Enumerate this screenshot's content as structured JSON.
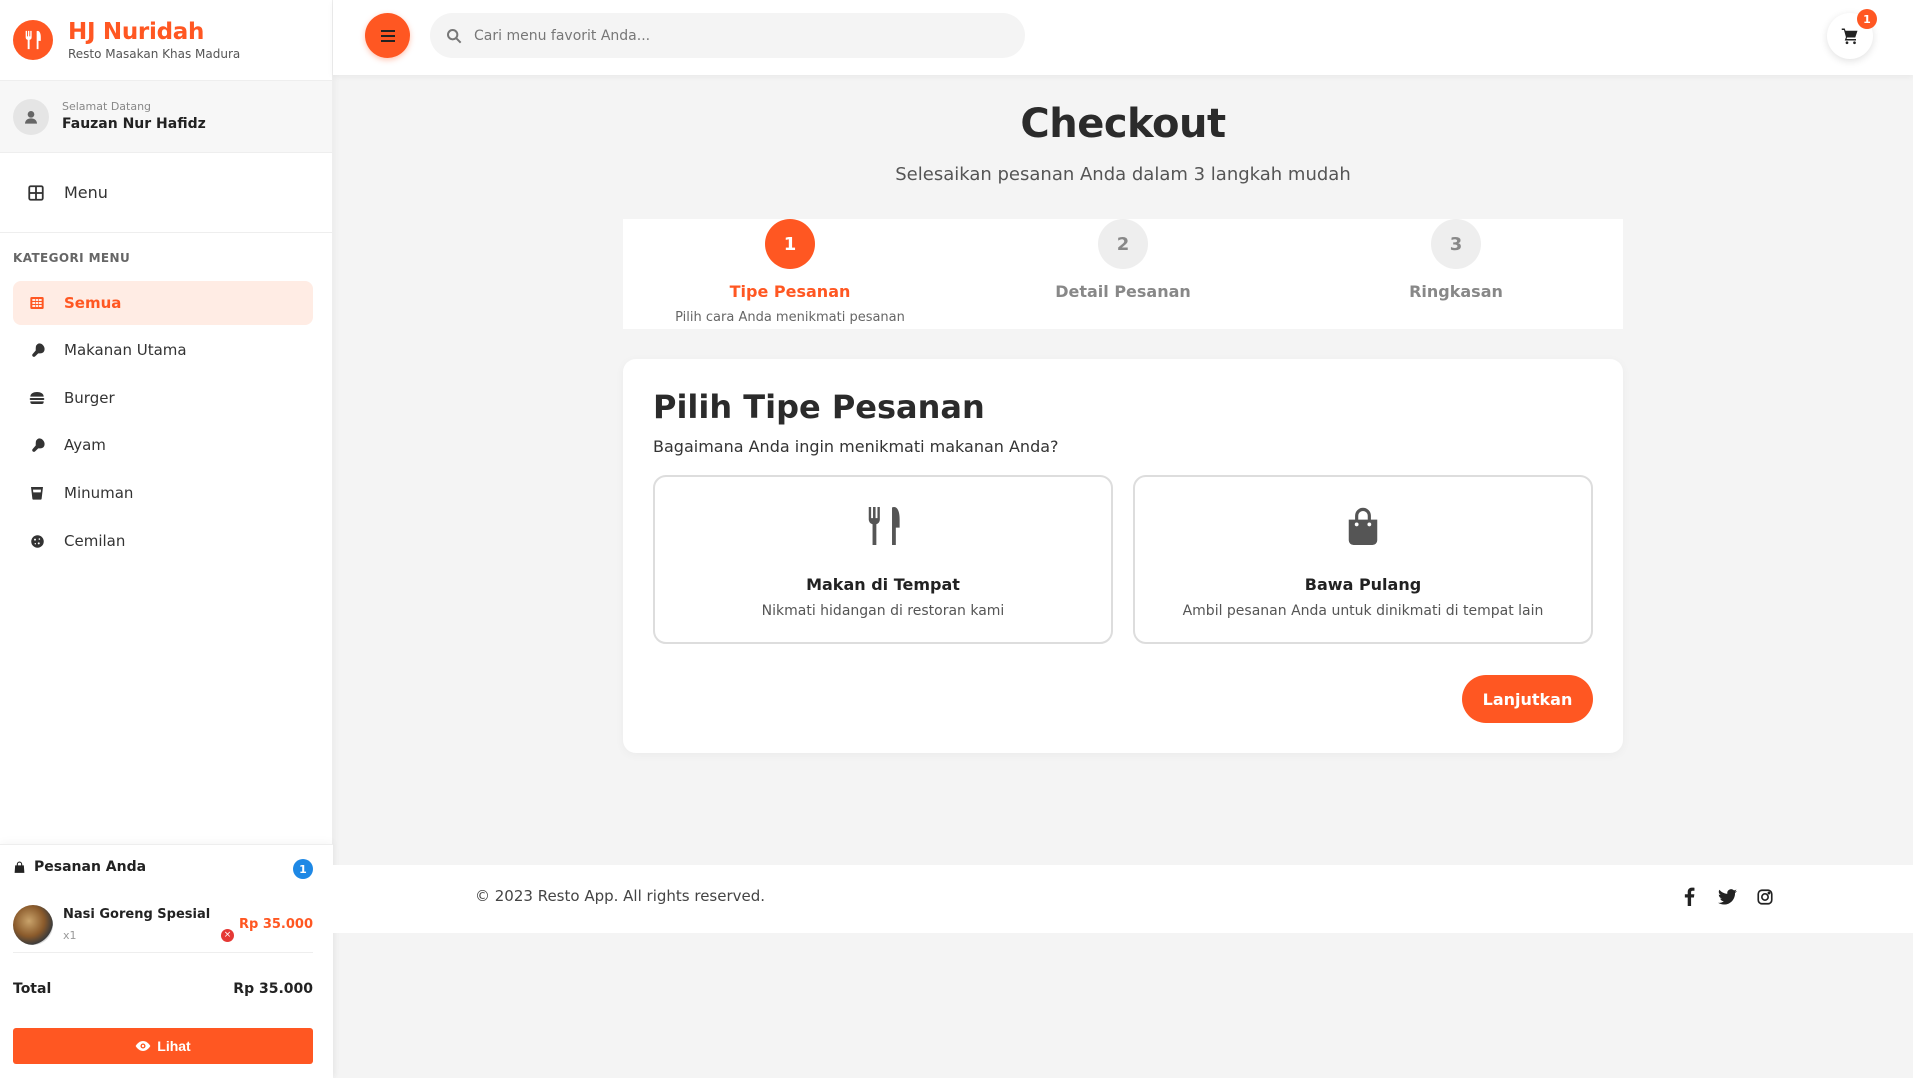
{
  "brand": {
    "name": "HJ Nuridah",
    "tagline": "Resto Masakan Khas Madura",
    "icon": "utensils-icon",
    "accent": "#ff5722"
  },
  "user": {
    "greeting": "Selamat Datang",
    "name": "Fauzan Nur Hafidz",
    "icon": "user-icon"
  },
  "sidebar": {
    "menu_label": "Menu",
    "category_title": "KATEGORI MENU",
    "categories": [
      {
        "label": "Semua",
        "icon": "grid-icon",
        "active": true
      },
      {
        "label": "Makanan Utama",
        "icon": "drumstick-icon",
        "active": false
      },
      {
        "label": "Burger",
        "icon": "burger-icon",
        "active": false
      },
      {
        "label": "Ayam",
        "icon": "drumstick-icon",
        "active": false
      },
      {
        "label": "Minuman",
        "icon": "cup-icon",
        "active": false
      },
      {
        "label": "Cemilan",
        "icon": "cookie-icon",
        "active": false
      }
    ]
  },
  "order": {
    "title": "Pesanan Anda",
    "count": "1",
    "items": [
      {
        "name": "Nasi Goreng Spesial",
        "qty": "x1",
        "price": "Rp 35.000"
      }
    ],
    "total_label": "Total",
    "total_value": "Rp 35.000",
    "view_button": "Lihat"
  },
  "topbar": {
    "search_placeholder": "Cari menu favorit Anda...",
    "cart_count": "1"
  },
  "checkout": {
    "title": "Checkout",
    "subtitle": "Selesaikan pesanan Anda dalam 3 langkah mudah",
    "steps": [
      {
        "number": "1",
        "label": "Tipe Pesanan",
        "desc": "Pilih cara Anda menikmati pesanan",
        "active": true
      },
      {
        "number": "2",
        "label": "Detail Pesanan",
        "desc": "",
        "active": false
      },
      {
        "number": "3",
        "label": "Ringkasan",
        "desc": "",
        "active": false
      }
    ],
    "card_title": "Pilih Tipe Pesanan",
    "card_question": "Bagaimana Anda ingin menikmati makanan Anda?",
    "options": [
      {
        "name": "Makan di Tempat",
        "desc": "Nikmati hidangan di restoran kami",
        "icon": "utensils-icon"
      },
      {
        "name": "Bawa Pulang",
        "desc": "Ambil pesanan Anda untuk dinikmati di tempat lain",
        "icon": "shopping-bag-icon"
      }
    ],
    "continue_button": "Lanjutkan"
  },
  "footer": {
    "copyright": "© 2023 Resto App. All rights reserved.",
    "social": [
      "facebook-icon",
      "twitter-icon",
      "instagram-icon"
    ]
  }
}
